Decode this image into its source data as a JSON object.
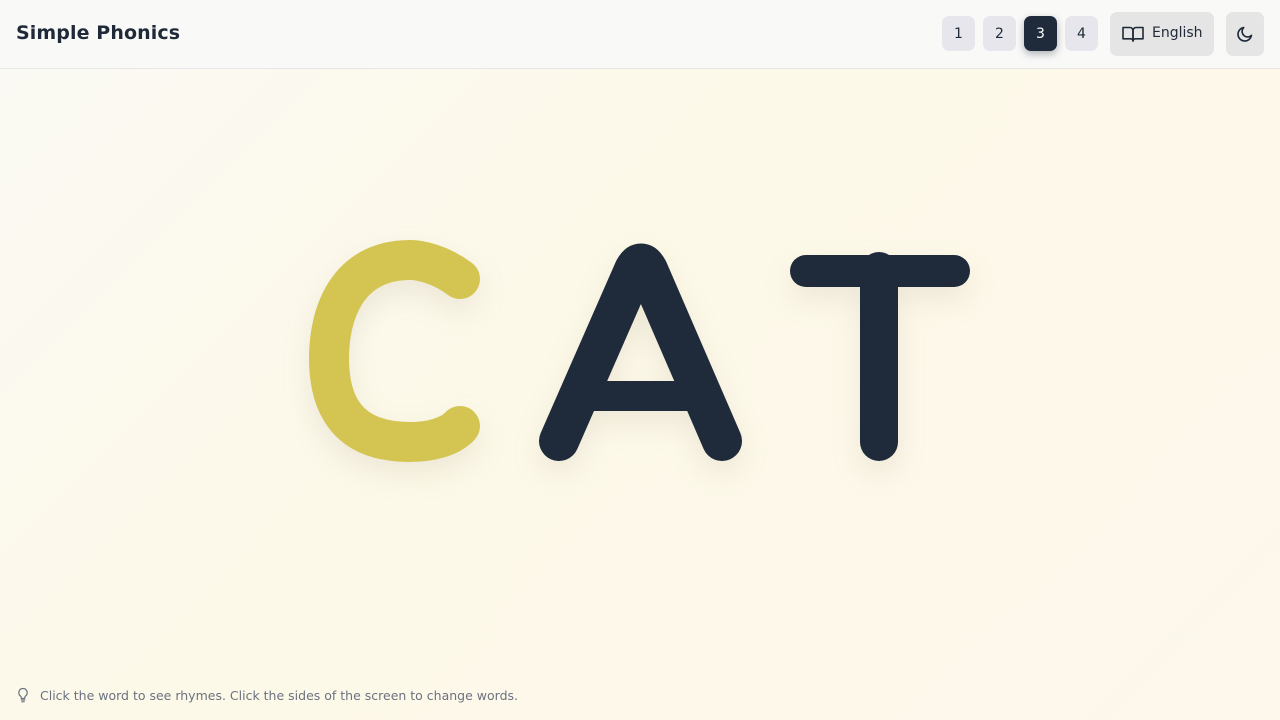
{
  "header": {
    "title": "Simple Phonics",
    "levels": [
      "1",
      "2",
      "3",
      "4"
    ],
    "active_level": "3",
    "language_label": "English",
    "language_icon": "book-open-icon",
    "theme_icon": "moon-icon"
  },
  "word": {
    "letters": [
      {
        "char": "C",
        "color": "#d4c552"
      },
      {
        "char": "A",
        "color": "#1f2a3b"
      },
      {
        "char": "T",
        "color": "#1f2a3b"
      }
    ]
  },
  "footer": {
    "hint_icon": "lightbulb-icon",
    "hint_text": "Click the word to see rhymes. Click the sides of the screen to change words."
  }
}
